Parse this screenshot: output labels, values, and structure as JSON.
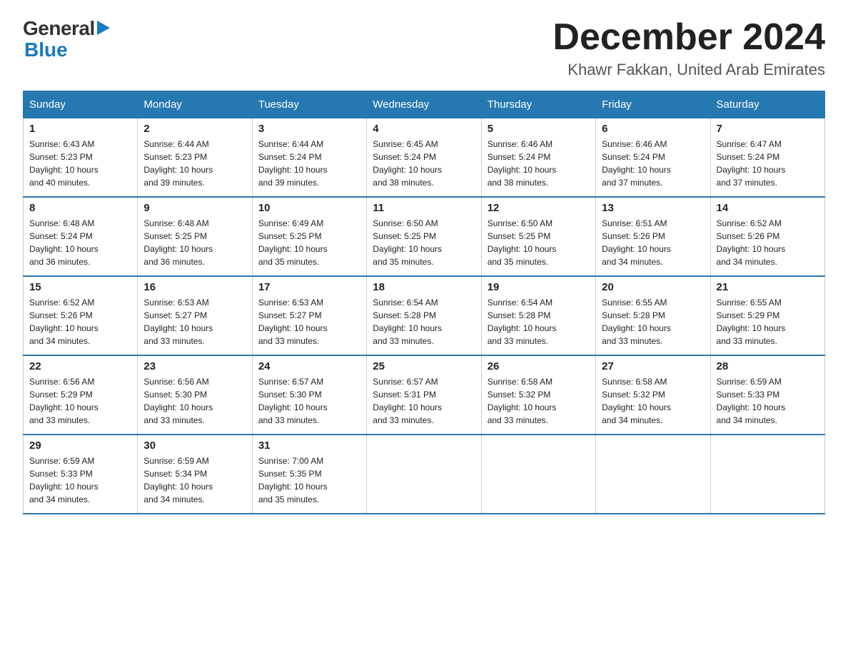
{
  "header": {
    "logo_general": "General",
    "logo_blue": "Blue",
    "month": "December 2024",
    "location": "Khawr Fakkan, United Arab Emirates"
  },
  "days_of_week": [
    "Sunday",
    "Monday",
    "Tuesday",
    "Wednesday",
    "Thursday",
    "Friday",
    "Saturday"
  ],
  "weeks": [
    [
      {
        "day": "1",
        "sunrise": "6:43 AM",
        "sunset": "5:23 PM",
        "daylight": "10 hours and 40 minutes."
      },
      {
        "day": "2",
        "sunrise": "6:44 AM",
        "sunset": "5:23 PM",
        "daylight": "10 hours and 39 minutes."
      },
      {
        "day": "3",
        "sunrise": "6:44 AM",
        "sunset": "5:24 PM",
        "daylight": "10 hours and 39 minutes."
      },
      {
        "day": "4",
        "sunrise": "6:45 AM",
        "sunset": "5:24 PM",
        "daylight": "10 hours and 38 minutes."
      },
      {
        "day": "5",
        "sunrise": "6:46 AM",
        "sunset": "5:24 PM",
        "daylight": "10 hours and 38 minutes."
      },
      {
        "day": "6",
        "sunrise": "6:46 AM",
        "sunset": "5:24 PM",
        "daylight": "10 hours and 37 minutes."
      },
      {
        "day": "7",
        "sunrise": "6:47 AM",
        "sunset": "5:24 PM",
        "daylight": "10 hours and 37 minutes."
      }
    ],
    [
      {
        "day": "8",
        "sunrise": "6:48 AM",
        "sunset": "5:24 PM",
        "daylight": "10 hours and 36 minutes."
      },
      {
        "day": "9",
        "sunrise": "6:48 AM",
        "sunset": "5:25 PM",
        "daylight": "10 hours and 36 minutes."
      },
      {
        "day": "10",
        "sunrise": "6:49 AM",
        "sunset": "5:25 PM",
        "daylight": "10 hours and 35 minutes."
      },
      {
        "day": "11",
        "sunrise": "6:50 AM",
        "sunset": "5:25 PM",
        "daylight": "10 hours and 35 minutes."
      },
      {
        "day": "12",
        "sunrise": "6:50 AM",
        "sunset": "5:25 PM",
        "daylight": "10 hours and 35 minutes."
      },
      {
        "day": "13",
        "sunrise": "6:51 AM",
        "sunset": "5:26 PM",
        "daylight": "10 hours and 34 minutes."
      },
      {
        "day": "14",
        "sunrise": "6:52 AM",
        "sunset": "5:26 PM",
        "daylight": "10 hours and 34 minutes."
      }
    ],
    [
      {
        "day": "15",
        "sunrise": "6:52 AM",
        "sunset": "5:26 PM",
        "daylight": "10 hours and 34 minutes."
      },
      {
        "day": "16",
        "sunrise": "6:53 AM",
        "sunset": "5:27 PM",
        "daylight": "10 hours and 33 minutes."
      },
      {
        "day": "17",
        "sunrise": "6:53 AM",
        "sunset": "5:27 PM",
        "daylight": "10 hours and 33 minutes."
      },
      {
        "day": "18",
        "sunrise": "6:54 AM",
        "sunset": "5:28 PM",
        "daylight": "10 hours and 33 minutes."
      },
      {
        "day": "19",
        "sunrise": "6:54 AM",
        "sunset": "5:28 PM",
        "daylight": "10 hours and 33 minutes."
      },
      {
        "day": "20",
        "sunrise": "6:55 AM",
        "sunset": "5:28 PM",
        "daylight": "10 hours and 33 minutes."
      },
      {
        "day": "21",
        "sunrise": "6:55 AM",
        "sunset": "5:29 PM",
        "daylight": "10 hours and 33 minutes."
      }
    ],
    [
      {
        "day": "22",
        "sunrise": "6:56 AM",
        "sunset": "5:29 PM",
        "daylight": "10 hours and 33 minutes."
      },
      {
        "day": "23",
        "sunrise": "6:56 AM",
        "sunset": "5:30 PM",
        "daylight": "10 hours and 33 minutes."
      },
      {
        "day": "24",
        "sunrise": "6:57 AM",
        "sunset": "5:30 PM",
        "daylight": "10 hours and 33 minutes."
      },
      {
        "day": "25",
        "sunrise": "6:57 AM",
        "sunset": "5:31 PM",
        "daylight": "10 hours and 33 minutes."
      },
      {
        "day": "26",
        "sunrise": "6:58 AM",
        "sunset": "5:32 PM",
        "daylight": "10 hours and 33 minutes."
      },
      {
        "day": "27",
        "sunrise": "6:58 AM",
        "sunset": "5:32 PM",
        "daylight": "10 hours and 34 minutes."
      },
      {
        "day": "28",
        "sunrise": "6:59 AM",
        "sunset": "5:33 PM",
        "daylight": "10 hours and 34 minutes."
      }
    ],
    [
      {
        "day": "29",
        "sunrise": "6:59 AM",
        "sunset": "5:33 PM",
        "daylight": "10 hours and 34 minutes."
      },
      {
        "day": "30",
        "sunrise": "6:59 AM",
        "sunset": "5:34 PM",
        "daylight": "10 hours and 34 minutes."
      },
      {
        "day": "31",
        "sunrise": "7:00 AM",
        "sunset": "5:35 PM",
        "daylight": "10 hours and 35 minutes."
      },
      null,
      null,
      null,
      null
    ]
  ],
  "labels": {
    "sunrise": "Sunrise:",
    "sunset": "Sunset:",
    "daylight": "Daylight:"
  }
}
